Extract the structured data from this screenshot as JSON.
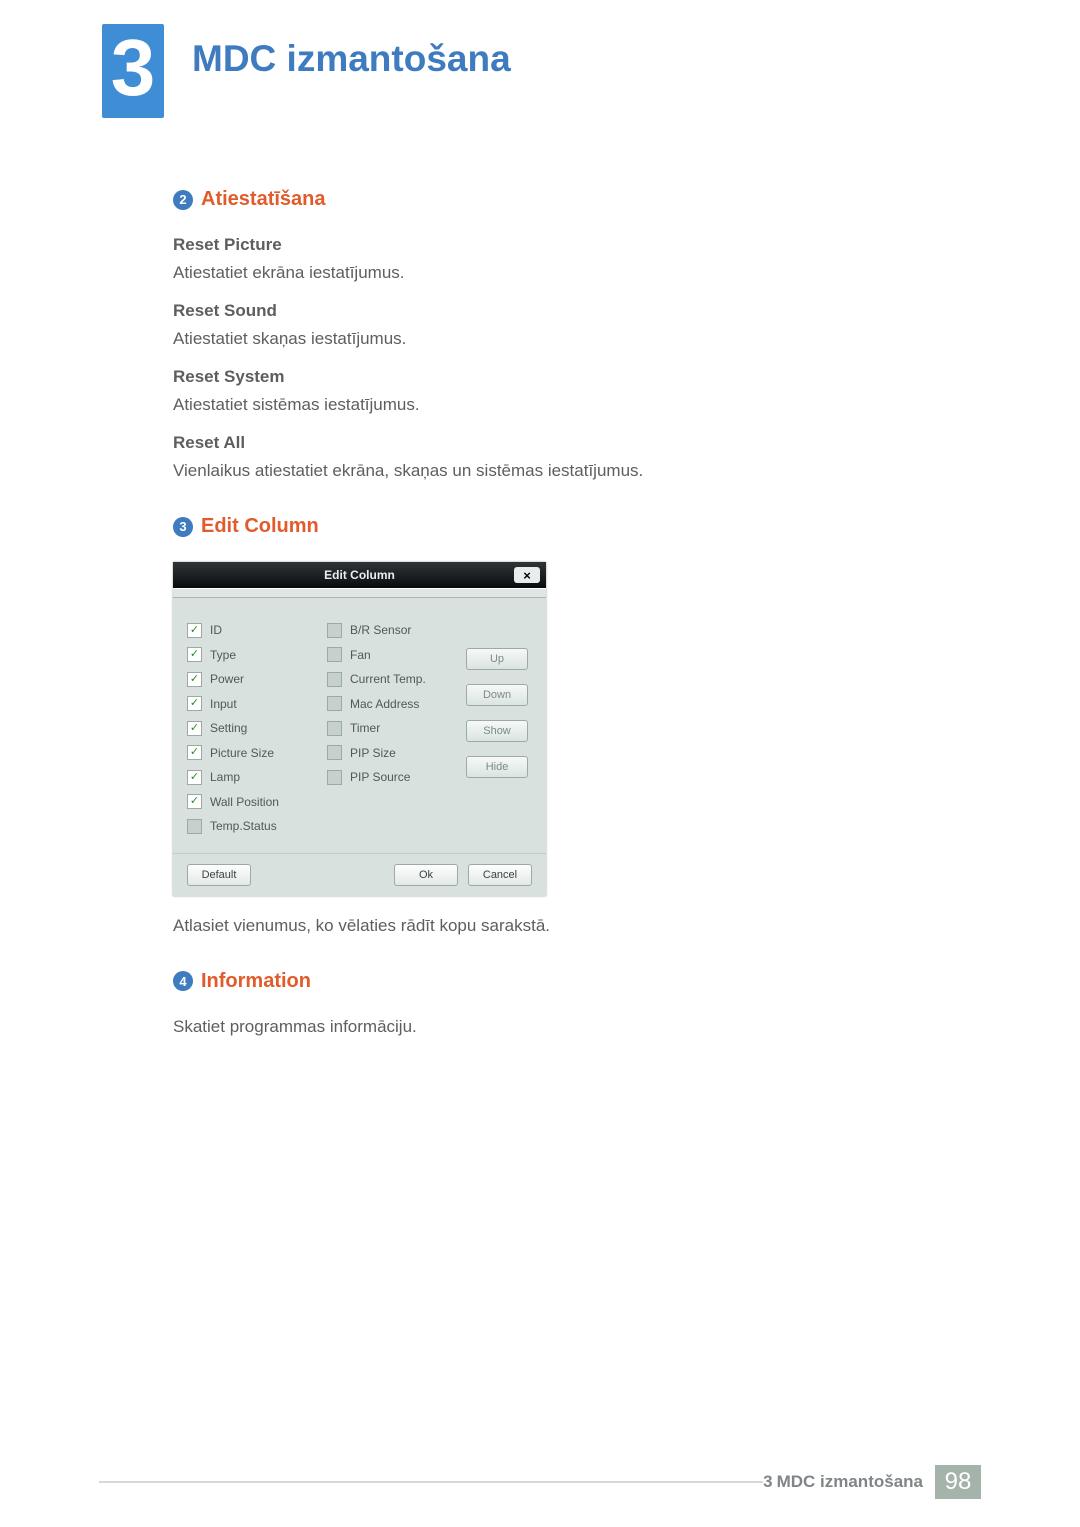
{
  "chapter": {
    "number": "3",
    "title": "MDC izmantošana"
  },
  "sections": {
    "reset": {
      "num": "2",
      "title": "Atiestatīšana",
      "items": [
        {
          "head": "Reset Picture",
          "body": "Atiestatiet ekrāna iestatījumus."
        },
        {
          "head": "Reset Sound",
          "body": "Atiestatiet skaņas iestatījumus."
        },
        {
          "head": "Reset System",
          "body": "Atiestatiet sistēmas iestatījumus."
        },
        {
          "head": "Reset All",
          "body": "Vienlaikus atiestatiet ekrāna, skaņas un sistēmas iestatījumus."
        }
      ]
    },
    "editcol": {
      "num": "3",
      "title": "Edit Column",
      "caption": "Atlasiet vienumus, ko vēlaties rādīt kopu sarakstā."
    },
    "info": {
      "num": "4",
      "title": "Information",
      "body": "Skatiet programmas informāciju."
    }
  },
  "dialog": {
    "title": "Edit Column",
    "close": "×",
    "col1": [
      {
        "label": "ID",
        "checked": true
      },
      {
        "label": "Type",
        "checked": true
      },
      {
        "label": "Power",
        "checked": true
      },
      {
        "label": "Input",
        "checked": true
      },
      {
        "label": "Setting",
        "checked": true
      },
      {
        "label": "Picture Size",
        "checked": true
      },
      {
        "label": "Lamp",
        "checked": true
      },
      {
        "label": "Wall Position",
        "checked": true
      },
      {
        "label": "Temp.Status",
        "checked": false
      }
    ],
    "col2": [
      {
        "label": "B/R Sensor",
        "checked": false
      },
      {
        "label": "Fan",
        "checked": false
      },
      {
        "label": "Current Temp.",
        "checked": false
      },
      {
        "label": "Mac Address",
        "checked": false
      },
      {
        "label": "Timer",
        "checked": false
      },
      {
        "label": "PIP Size",
        "checked": false
      },
      {
        "label": "PIP Source",
        "checked": false
      }
    ],
    "side_buttons": {
      "up": "Up",
      "down": "Down",
      "show": "Show",
      "hide": "Hide"
    },
    "footer": {
      "default": "Default",
      "ok": "Ok",
      "cancel": "Cancel"
    }
  },
  "footer": {
    "chapter_num": "3",
    "chapter_title": "MDC izmantošana",
    "page": "98"
  }
}
